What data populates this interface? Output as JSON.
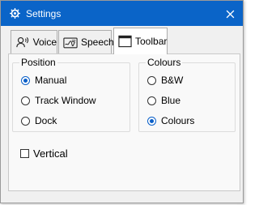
{
  "window": {
    "title": "Settings"
  },
  "tabs": [
    {
      "label": "Voice",
      "icon": "voice-icon",
      "active": false
    },
    {
      "label": "Speech",
      "icon": "speech-icon",
      "active": false
    },
    {
      "label": "Toolbar",
      "icon": "toolbar-icon",
      "active": true
    }
  ],
  "position": {
    "label": "Position",
    "options": [
      {
        "label": "Manual",
        "selected": true
      },
      {
        "label": "Track Window",
        "selected": false
      },
      {
        "label": "Dock",
        "selected": false
      }
    ]
  },
  "colours": {
    "label": "Colours",
    "options": [
      {
        "label": "B&W",
        "selected": false
      },
      {
        "label": "Blue",
        "selected": false
      },
      {
        "label": "Colours",
        "selected": true
      }
    ]
  },
  "vertical": {
    "label": "Vertical",
    "checked": false
  },
  "colors": {
    "titlebar": "#0a64c8",
    "accent": "#0a5fc8"
  }
}
